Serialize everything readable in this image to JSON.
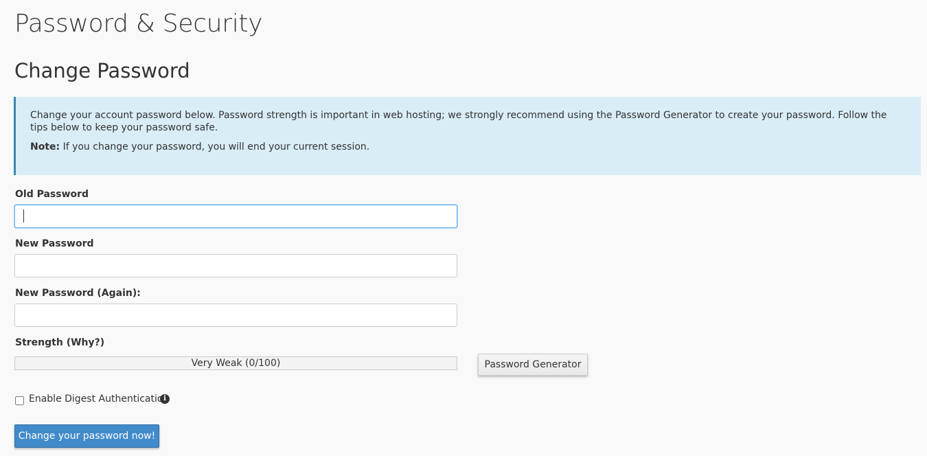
{
  "page": {
    "title": "Password & Security",
    "section_title": "Change Password"
  },
  "info": {
    "message": "Change your account password below. Password strength is important in web hosting; we strongly recommend using the Password Generator to create your password. Follow the tips below to keep your password safe.",
    "note_label": "Note:",
    "note_text": " If you change your password, you will end your current session."
  },
  "form": {
    "old_password_label": "Old Password",
    "old_password_value": "",
    "new_password_label": "New Password",
    "new_password_value": "",
    "new_password_again_label": "New Password (Again):",
    "new_password_again_value": "",
    "strength_label": "Strength (Why?)",
    "strength_text": "Very Weak (0/100)",
    "strength_value": 0,
    "strength_color": "#d9534f",
    "generator_button": "Password Generator",
    "digest_checkbox_label": "Enable Digest Authentication",
    "digest_checked": false,
    "info_icon": "info-circle-icon",
    "submit_button": "Change your password now!"
  },
  "colors": {
    "background": "#f9f9f9",
    "info_background": "#d9edf7",
    "info_border": "#3a87ad",
    "primary_button": "#428bca",
    "focus_border": "#66afe9"
  }
}
